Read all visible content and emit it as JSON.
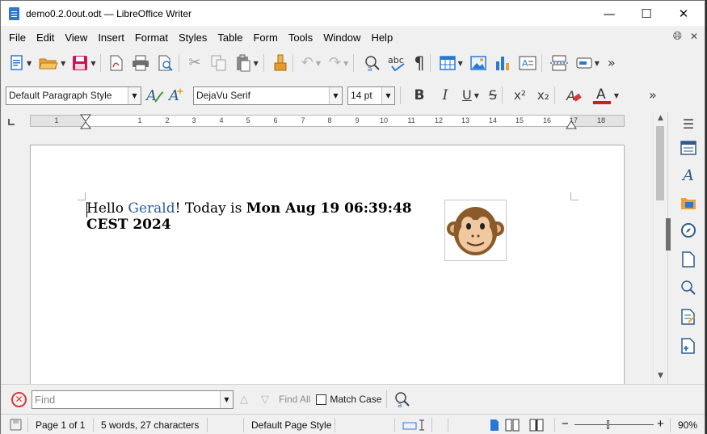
{
  "window": {
    "title": "demo0.2.0out.odt — LibreOffice Writer",
    "controls": {
      "minimize": "—",
      "maximize": "☐",
      "close": "✕"
    }
  },
  "menu": {
    "items": [
      "File",
      "Edit",
      "View",
      "Insert",
      "Format",
      "Styles",
      "Table",
      "Form",
      "Tools",
      "Window",
      "Help"
    ],
    "right_icons": [
      "globe-icon",
      "close-document-icon"
    ]
  },
  "toolbar_standard": {
    "icons": [
      "new-document-icon",
      "open-folder-icon",
      "save-icon",
      "export-pdf-icon",
      "print-icon",
      "print-preview-icon",
      "cut-icon",
      "copy-icon",
      "paste-icon",
      "clone-formatting-icon",
      "undo-icon",
      "redo-icon",
      "find-replace-icon",
      "spelling-icon",
      "formatting-marks-icon",
      "insert-table-icon",
      "insert-image-icon",
      "insert-chart-icon",
      "insert-text-box-icon",
      "page-break-icon",
      "insert-field-icon",
      "more-icon"
    ]
  },
  "toolbar_formatting": {
    "paragraph_style": "Default Paragraph Style",
    "font_name": "DejaVu Serif",
    "font_size": "14 pt",
    "bold": "B",
    "italic": "I",
    "underline": "U",
    "strikethrough": "S",
    "superscript": "x²",
    "subscript": "x₂",
    "font_color": "#c9211e"
  },
  "ruler": {
    "numbers": [
      "1",
      "1",
      "2",
      "3",
      "4",
      "5",
      "6",
      "7",
      "8",
      "9",
      "10",
      "11",
      "12",
      "13",
      "14",
      "15",
      "16",
      "17",
      "18",
      "19"
    ]
  },
  "document": {
    "line1": {
      "greeting": "Hello ",
      "name": "Gerald",
      "middle": "! Today is ",
      "date_part1": "Mon Aug 19 06:39:48"
    },
    "line2": {
      "date_part2": "CEST 2024"
    },
    "image": "monkey-face-image",
    "name_color": "#2a5d99"
  },
  "sidebar": {
    "icons": [
      "sidebar-menu-icon",
      "properties-icon",
      "styles-icon",
      "gallery-icon",
      "navigator-icon",
      "page-icon",
      "style-inspector-icon",
      "manage-changes-icon",
      "design-icon"
    ]
  },
  "findbar": {
    "placeholder": "Find",
    "find_all": "Find All",
    "match_case": "Match Case"
  },
  "statusbar": {
    "page": "Page 1 of 1",
    "word_count": "5 words, 27 characters",
    "page_style": "Default Page Style",
    "zoom": "90%",
    "zoom_minus": "−",
    "zoom_plus": "+"
  }
}
